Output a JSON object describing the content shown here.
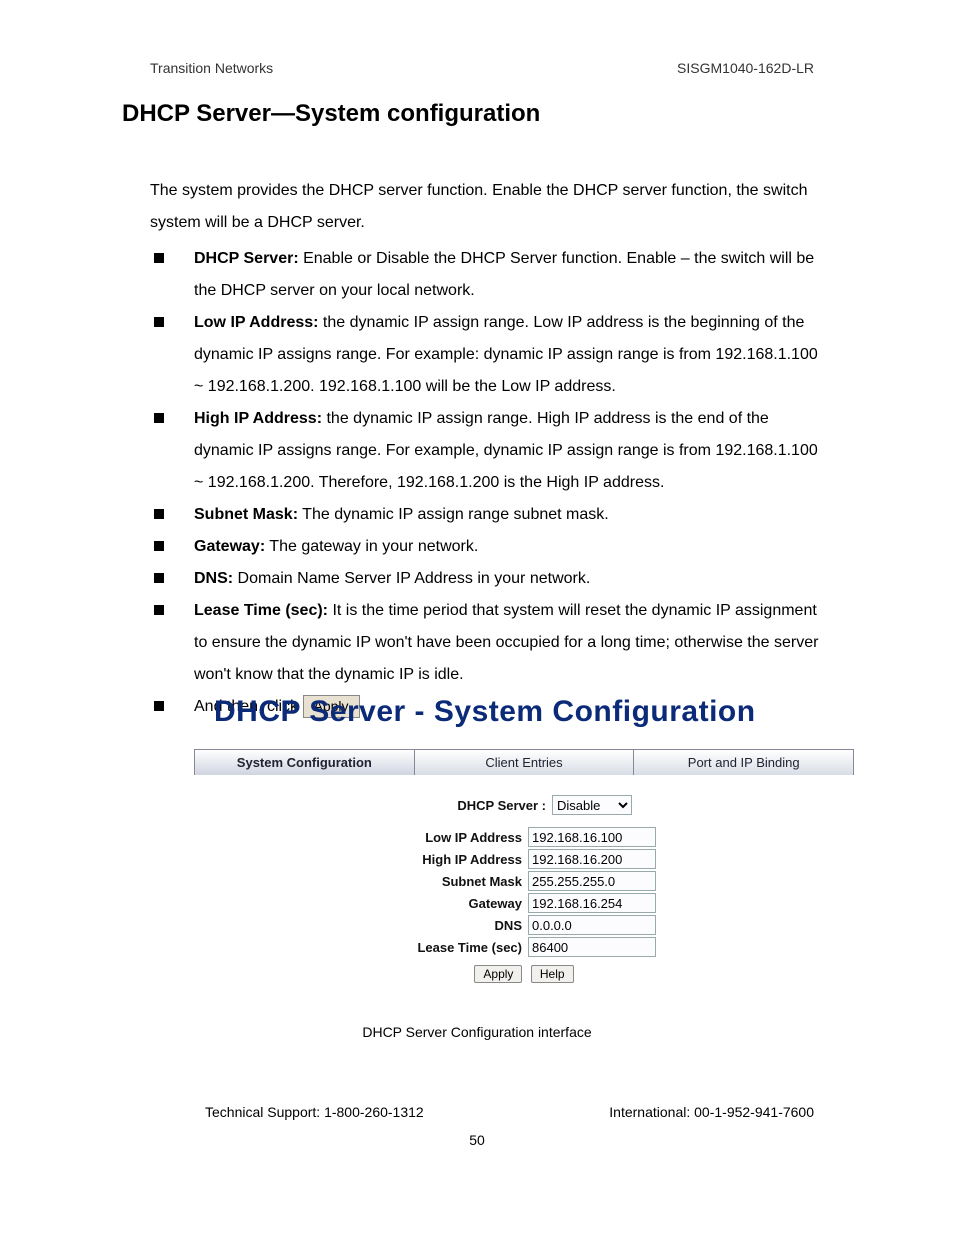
{
  "header": {
    "left": "Transition Networks",
    "right": "SISGM1040-162D-LR"
  },
  "title": "DHCP Server—System configuration",
  "intro": "The system provides the DHCP server function. Enable the DHCP server function, the switch system will be a DHCP server.",
  "bullets": [
    {
      "term": "DHCP Server:",
      "text": " Enable or Disable the DHCP Server function. Enable – the switch will be the DHCP server on your local network."
    },
    {
      "term": "Low IP Address:",
      "text": " the dynamic IP assign range. Low IP address is the beginning of the dynamic IP assigns range. For example: dynamic IP assign range is from 192.168.1.100 ~ 192.168.1.200. 192.168.1.100 will be the Low IP address."
    },
    {
      "term": "High IP Address:",
      "text": " the dynamic IP assign range. High IP address is the end of the dynamic IP assigns range. For example, dynamic IP assign range is from 192.168.1.100 ~ 192.168.1.200. Therefore, 192.168.1.200 is the High IP address."
    },
    {
      "term": "Subnet Mask:",
      "text": " The dynamic IP assign range subnet mask."
    },
    {
      "term": "Gateway:",
      "text": " The gateway in your network."
    },
    {
      "term": "DNS:",
      "text": " Domain Name Server IP Address in your network."
    },
    {
      "term": "Lease Time (sec):",
      "text": " It is the time period that system will reset the dynamic IP assignment to ensure the dynamic IP won't have been occupied for a long time; otherwise the server won't know that the dynamic IP is idle."
    }
  ],
  "last_line": {
    "pre": "And then, click ",
    "button": "Apply"
  },
  "ui": {
    "heading": "DHCP Server - System Configuration",
    "tabs": [
      "System Configuration",
      "Client Entries",
      "Port and IP Binding"
    ],
    "dhcp_label": "DHCP Server :",
    "dhcp_value": "Disable",
    "fields": [
      {
        "label": "Low IP Address",
        "value": "192.168.16.100"
      },
      {
        "label": "High IP Address",
        "value": "192.168.16.200"
      },
      {
        "label": "Subnet Mask",
        "value": "255.255.255.0"
      },
      {
        "label": "Gateway",
        "value": "192.168.16.254"
      },
      {
        "label": "DNS",
        "value": "0.0.0.0"
      },
      {
        "label": "Lease Time (sec)",
        "value": "86400"
      }
    ],
    "apply": "Apply",
    "help": "Help"
  },
  "caption": "DHCP Server Configuration interface",
  "footer": {
    "left": "Technical Support: 1-800-260-1312",
    "right": "International: 00-1-952-941-7600"
  },
  "pageno": "50"
}
